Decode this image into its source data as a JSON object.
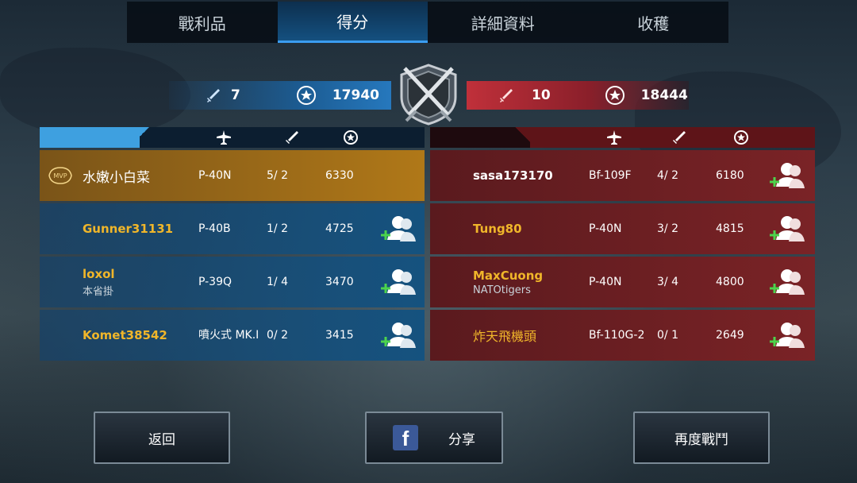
{
  "tabs": [
    {
      "label": "戰利品",
      "active": false
    },
    {
      "label": "得分",
      "active": true
    },
    {
      "label": "詳細資料",
      "active": false
    },
    {
      "label": "收穫",
      "active": false
    }
  ],
  "score": {
    "blue": {
      "kills": "7",
      "points": "17940"
    },
    "red": {
      "kills": "10",
      "points": "18444"
    }
  },
  "blue_team": [
    {
      "name": "水嫩小白菜",
      "sub": "",
      "plane": "P-40N",
      "kd": "5/ 2",
      "score": "6330",
      "mvp": true,
      "mvp_label": "MVP"
    },
    {
      "name": "Gunner31131",
      "sub": "",
      "plane": "P-40B",
      "kd": "1/ 2",
      "score": "4725",
      "mvp": false
    },
    {
      "name": "loxol",
      "sub": "本省掛",
      "plane": "P-39Q",
      "kd": "1/ 4",
      "score": "3470",
      "mvp": false
    },
    {
      "name": "Komet38542",
      "sub": "",
      "plane": "噴火式 MK.I",
      "kd": "0/ 2",
      "score": "3415",
      "mvp": false
    }
  ],
  "red_team": [
    {
      "name": "sasa173170",
      "sub": "",
      "plane": "Bf-109F",
      "kd": "4/ 2",
      "score": "6180"
    },
    {
      "name": "Tung80",
      "sub": "",
      "plane": "P-40N",
      "kd": "3/ 2",
      "score": "4815"
    },
    {
      "name": "MaxCuong",
      "sub": "NATOtigers",
      "plane": "P-40N",
      "kd": "3/ 4",
      "score": "4800"
    },
    {
      "name": "炸天飛機頭",
      "sub": "",
      "plane": "Bf-110G-2",
      "kd": "0/ 1",
      "score": "2649"
    }
  ],
  "buttons": {
    "back": "返回",
    "share": "分享",
    "fight_again": "再度戰鬥",
    "facebook_glyph": "f"
  },
  "colors": {
    "blue": "#1c5c93",
    "red": "#8a1f2a",
    "gold": "#f0b62a",
    "mvp": "#b07818"
  }
}
